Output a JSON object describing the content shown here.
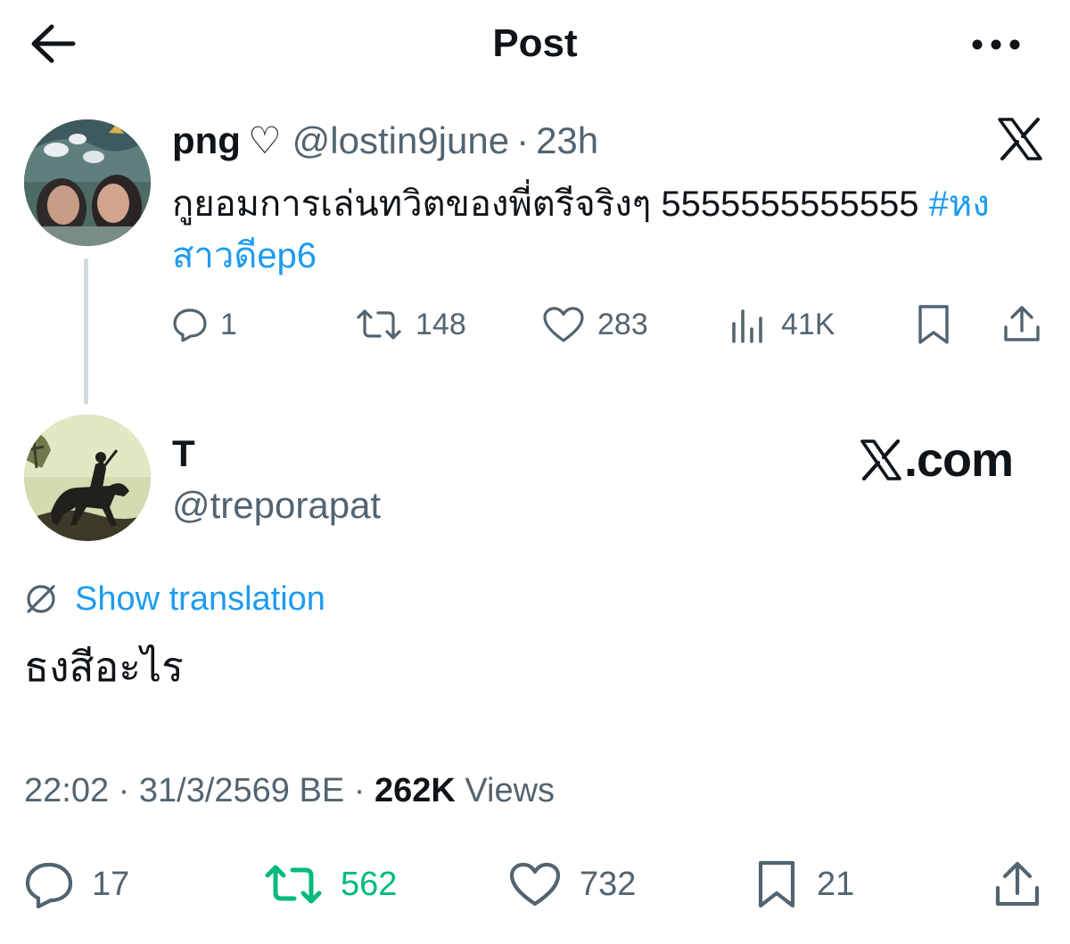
{
  "header": {
    "title": "Post",
    "back_icon": "arrow-left-icon",
    "more_icon": "more-horizontal-icon"
  },
  "quoted_tweet": {
    "display_name": "png",
    "name_emoji": "♡",
    "handle": "@lostin9june",
    "time": "23h",
    "separator": "·",
    "text": "กูยอมการเล่นทวิตของพี่ตรีจริงๆ 5555555555555",
    "hashtag": "#หงสาวดีep6",
    "replies": "1",
    "reposts": "148",
    "likes": "283",
    "views": "41K",
    "logo": "X"
  },
  "tweet": {
    "display_name": "T",
    "handle": "@treporapat",
    "watermark": ".com",
    "show_translation": "Show translation",
    "text": "ธงสีอะไร",
    "time": "22:02",
    "date": "31/3/2569 BE",
    "separator": "·",
    "views_count": "262K",
    "views_label": "Views",
    "replies": "17",
    "reposts": "562",
    "likes": "732",
    "bookmarks": "21"
  },
  "colors": {
    "link": "#1d9bf0",
    "secondary_text": "#536471",
    "primary_text": "#0f1419",
    "repost_active": "#00ba7c"
  }
}
